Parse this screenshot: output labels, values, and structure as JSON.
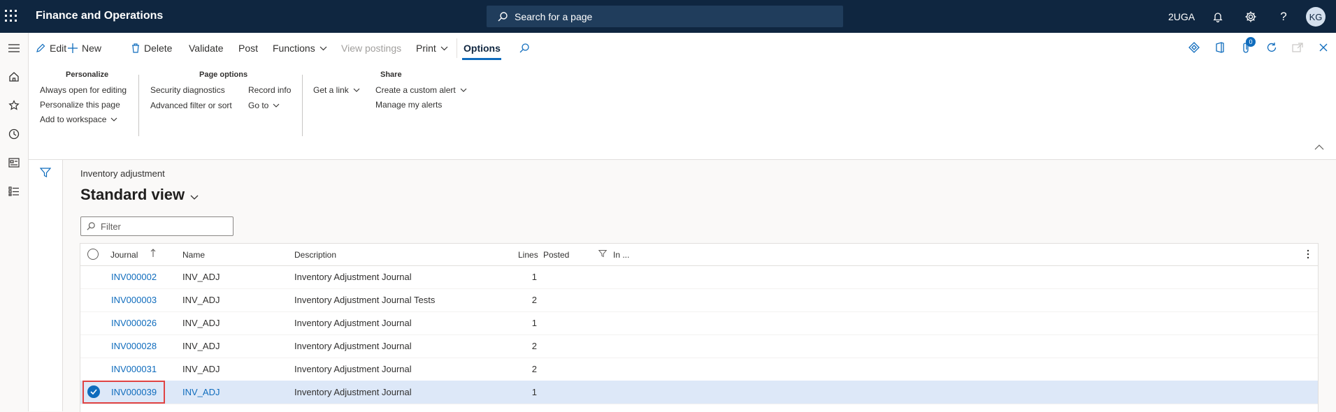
{
  "app": {
    "title": "Finance and Operations",
    "search_label": "Search for a page",
    "company": "2UGA",
    "user_initials": "KG"
  },
  "actions": {
    "edit": "Edit",
    "new": "New",
    "delete": "Delete",
    "validate": "Validate",
    "post": "Post",
    "functions": "Functions",
    "view_postings": "View postings",
    "print": "Print",
    "options": "Options",
    "notification_count": "0"
  },
  "options": {
    "personalize": {
      "title": "Personalize",
      "always_open": "Always open for editing",
      "personalize_page": "Personalize this page",
      "add_workspace": "Add to workspace"
    },
    "page_options": {
      "title": "Page options",
      "security_diagnostics": "Security diagnostics",
      "advanced_filter": "Advanced filter or sort",
      "record_info": "Record info",
      "go_to": "Go to"
    },
    "share": {
      "title": "Share",
      "get_link": "Get a link",
      "custom_alert": "Create a custom alert",
      "manage_alerts": "Manage my alerts"
    }
  },
  "page": {
    "breadcrumb": "Inventory adjustment",
    "view_name": "Standard view",
    "filter_placeholder": "Filter"
  },
  "grid": {
    "columns": {
      "journal": "Journal",
      "name": "Name",
      "description": "Description",
      "lines": "Lines",
      "posted": "Posted",
      "in": "In ..."
    },
    "rows": [
      {
        "journal": "INV000002",
        "name": "INV_ADJ",
        "description": "Inventory Adjustment Journal",
        "lines": "1",
        "selected": false
      },
      {
        "journal": "INV000003",
        "name": "INV_ADJ",
        "description": "Inventory Adjustment Journal Tests",
        "lines": "2",
        "selected": false
      },
      {
        "journal": "INV000026",
        "name": "INV_ADJ",
        "description": "Inventory Adjustment Journal",
        "lines": "1",
        "selected": false
      },
      {
        "journal": "INV000028",
        "name": "INV_ADJ",
        "description": "Inventory Adjustment Journal",
        "lines": "2",
        "selected": false
      },
      {
        "journal": "INV000031",
        "name": "INV_ADJ",
        "description": "Inventory Adjustment Journal",
        "lines": "2",
        "selected": false
      },
      {
        "journal": "INV000039",
        "name": "INV_ADJ",
        "description": "Inventory Adjustment Journal",
        "lines": "1",
        "selected": true
      }
    ]
  },
  "colors": {
    "nav_bar": "#0f2640",
    "accent": "#0f6cbd",
    "selected_row": "#dde8f8",
    "highlight_box": "#e04343"
  }
}
